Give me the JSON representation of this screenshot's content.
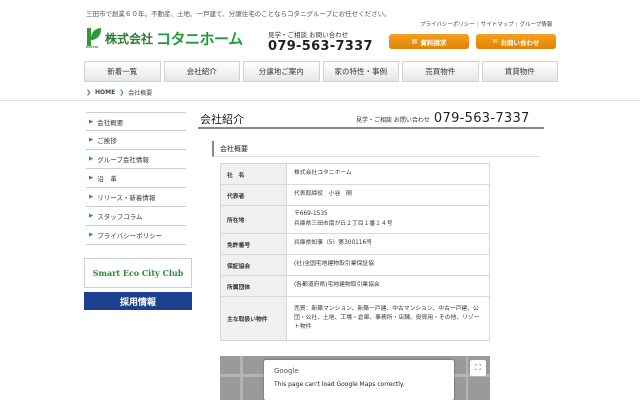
{
  "header": {
    "tagline": "三田市で創業６０年。不動産、土地、一戸建て、分譲住宅のことならコタニグループにお任せください。",
    "top_links": [
      "プライバシーポリシー",
      "サイトマップ",
      "グループ情報"
    ],
    "logo_company": "株式会社",
    "logo_name": "コタニホーム",
    "logo_mark_caption": "KOTANI",
    "contact_label": "見学・ご相談 お問い合わせ",
    "tel": "079-563-7337",
    "request_button": "資料請求",
    "inquiry_button": "お問い合わせ"
  },
  "gnav": [
    "新着一覧",
    "会社紹介",
    "分譲地ご案内",
    "家の特性・事例",
    "売買物件",
    "賃貸物件"
  ],
  "breadcrumb": {
    "home": "HOME",
    "current": "会社概要"
  },
  "sidebar": {
    "items": [
      "会社概要",
      "ご挨拶",
      "グループ会社情報",
      "沿　革",
      "リリース・新着情報",
      "スタッフコラム",
      "プライバシーポリシー"
    ]
  },
  "banners": {
    "eco": "Smart Eco City Club",
    "recruit": "採用情報"
  },
  "main": {
    "title": "会社紹介",
    "contact_label": "見学・ご相談 お問い合わせ",
    "tel": "079-563-7337",
    "section_title": "会社概要",
    "rows": [
      {
        "label": "社　名",
        "value": "株式会社コタニホーム"
      },
      {
        "label": "代表者",
        "value": "代表取締役　小谷　剛"
      },
      {
        "label": "所在地",
        "value": "〒669-1535",
        "value2": "兵庫県三田市南が丘２丁目１番１４号"
      },
      {
        "label": "免許番号",
        "value": "兵庫県知事（5）第300116号"
      },
      {
        "label": "保証協会",
        "value": "(社)全国宅地建物取引業保証協"
      },
      {
        "label": "所属団体",
        "value": "(各都道府県)宅地建物取引業協会"
      },
      {
        "label": "主な取扱い物件",
        "value": "売買：新築マンション、新築一戸建、中古マンション、中古一戸建、公団・公社、土地、工場・倉庫、事務所・店舗、投資用・その他、リゾート物件"
      }
    ]
  },
  "map": {
    "brand": "Google",
    "error": "This page can't load Google Maps correctly.",
    "fullscreen_icon": "fullscreen-icon"
  },
  "colors": {
    "brand_green": "#2e9a3a",
    "orange": "#f39800",
    "navy": "#1c3f8f"
  }
}
